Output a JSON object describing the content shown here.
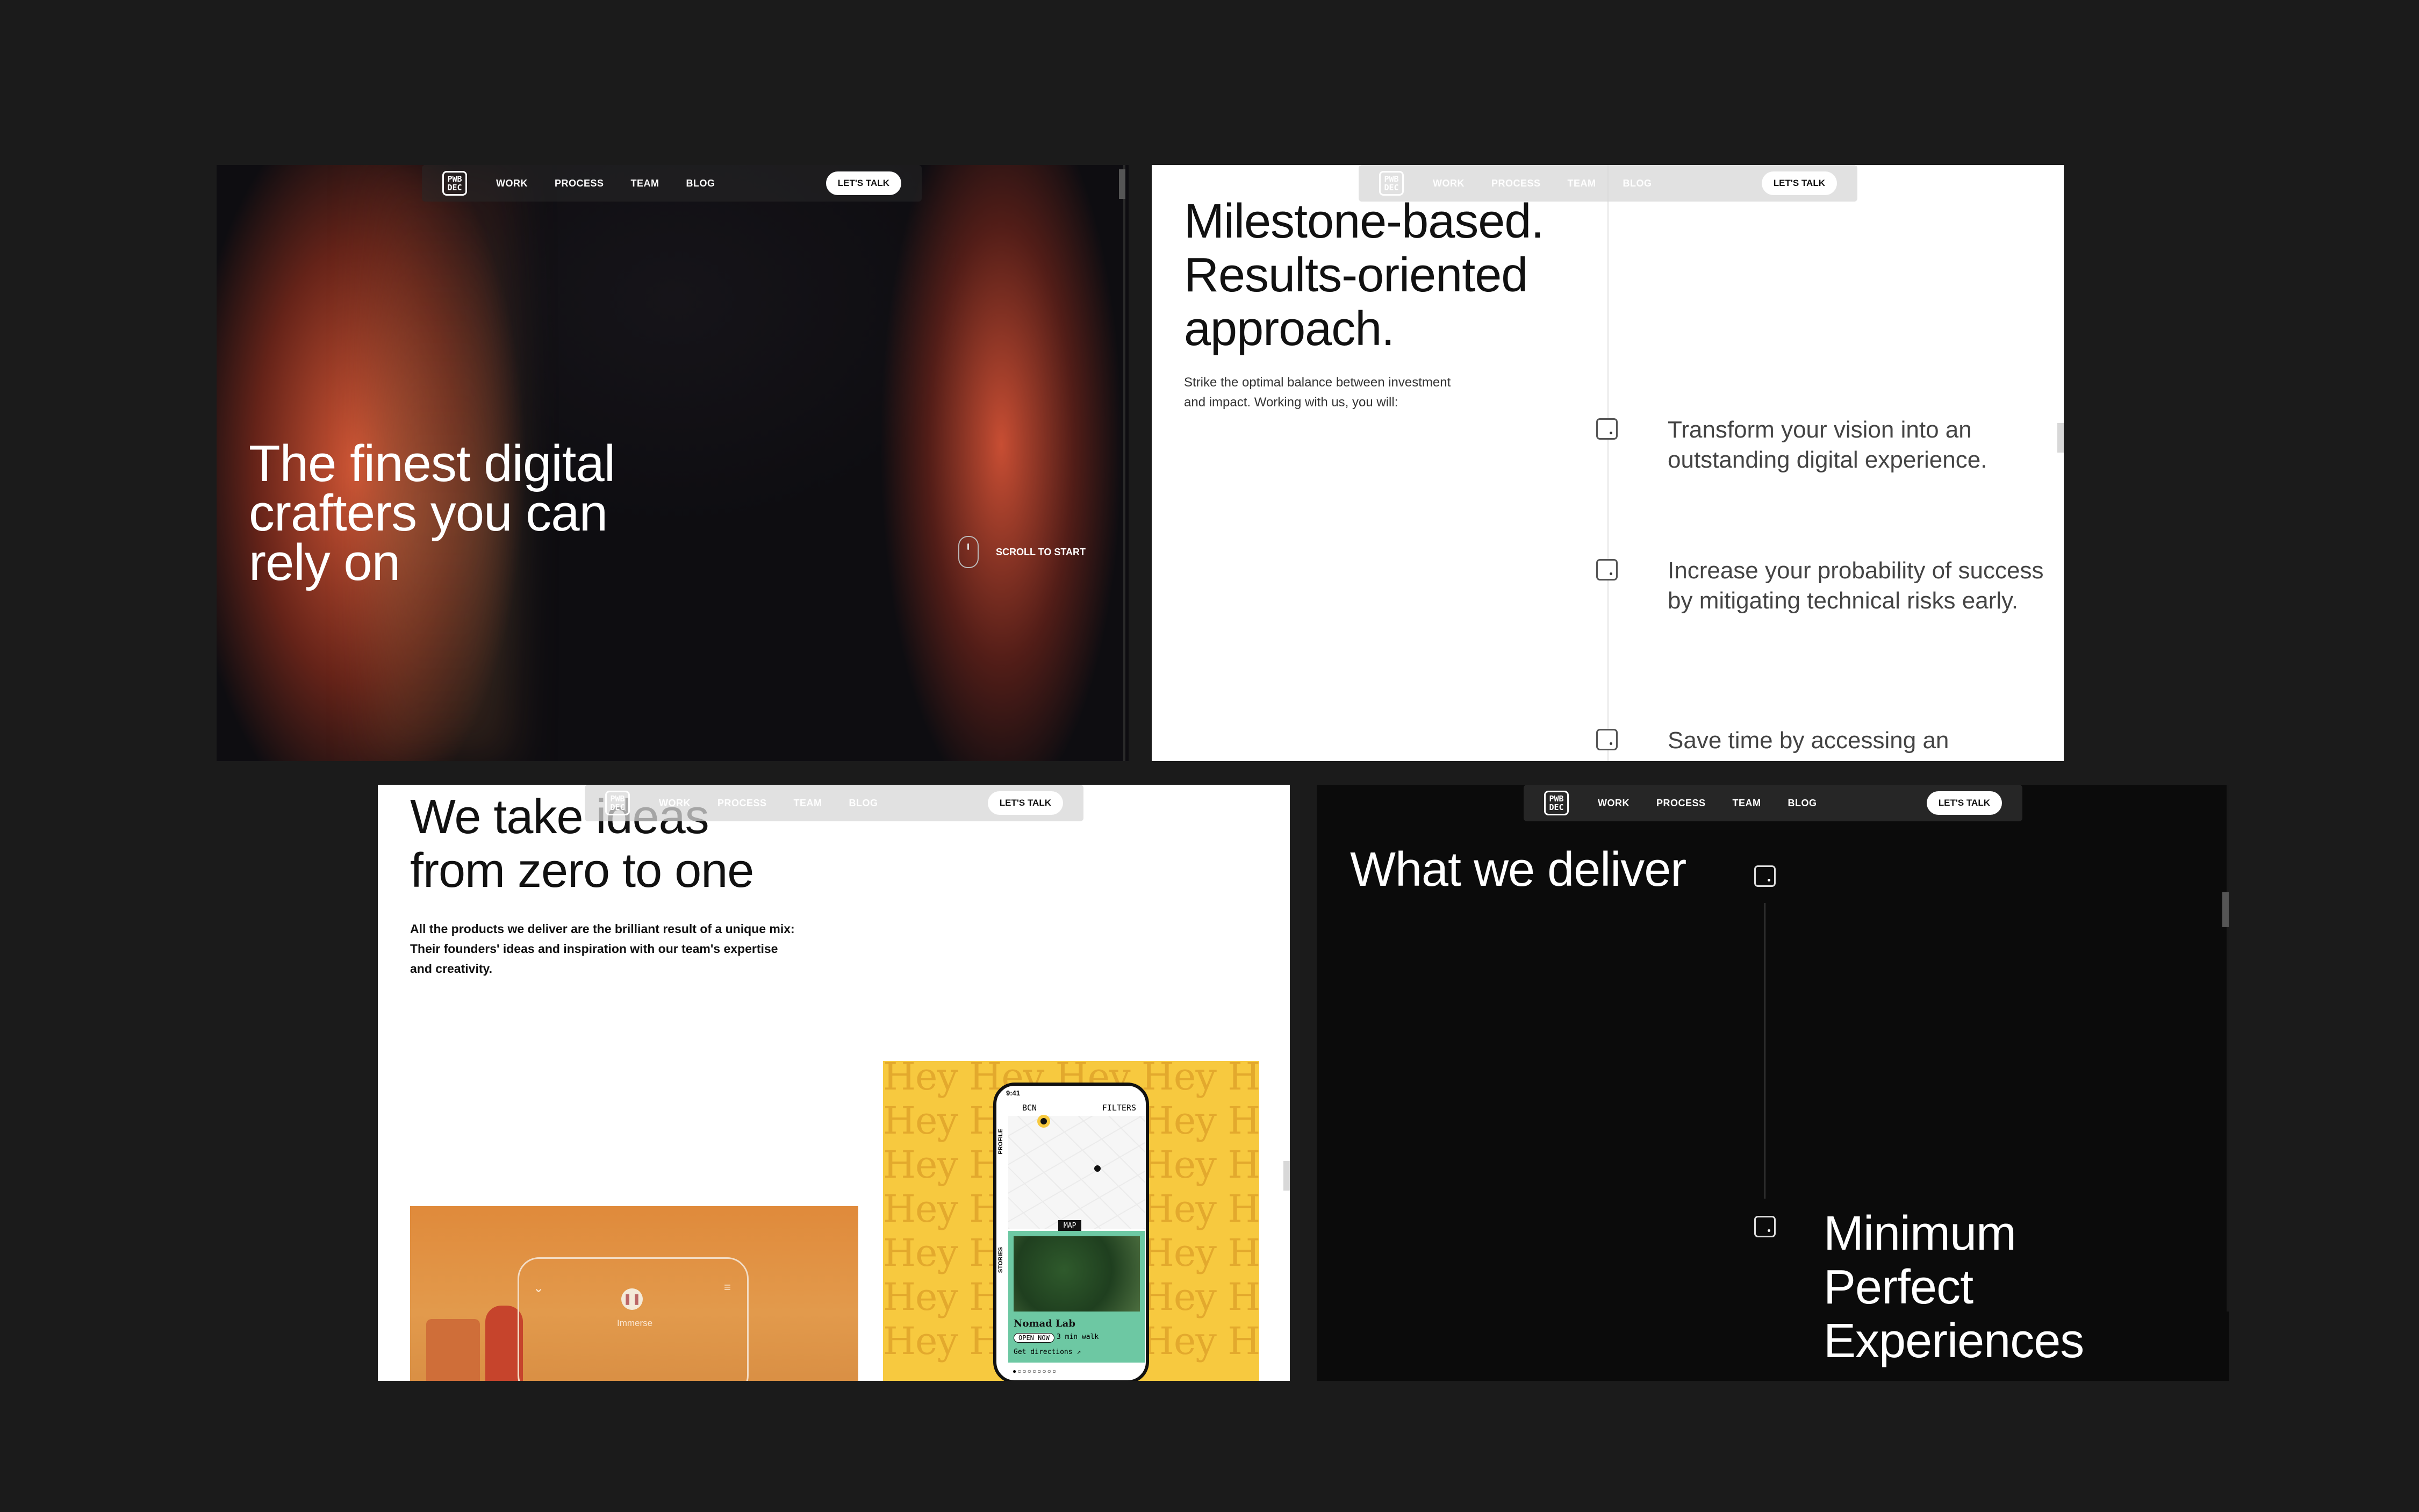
{
  "nav": {
    "logo_line1": "PWB",
    "logo_line2": "DEC",
    "items": [
      "WORK",
      "PROCESS",
      "TEAM",
      "BLOG"
    ],
    "cta": "LET'S TALK"
  },
  "panel1": {
    "hero_line1": "The finest digital",
    "hero_line2": "crafters you can",
    "hero_line3": "rely on",
    "scroll_label": "SCROLL TO START"
  },
  "panel2": {
    "title_line1": "Milestone-based.",
    "title_line2": "Results-oriented",
    "title_line3": "approach.",
    "subtitle_line1": "Strike the optimal balance between investment",
    "subtitle_line2": "and impact. Working with us, you will:",
    "points": [
      "Transform your vision into an outstanding digital experience.",
      "Increase your probability of success by mitigating technical risks early.",
      "Save time by accessing an"
    ]
  },
  "panel3": {
    "title_line1": "We take ideas",
    "title_line2": "from zero to one",
    "subtitle_line1": "All the products we deliver are the brilliant result of a unique mix:",
    "subtitle_line2": "Their founders' ideas and inspiration with our team's expertise",
    "subtitle_line3": "and creativity.",
    "orange_card": {
      "label": "Immerse"
    },
    "yellow_card": {
      "pattern_word": "Hey",
      "phone": {
        "time": "9:41",
        "city": "BCN",
        "filters": "FILTERS",
        "profile": "PROFILE",
        "stories": "STORIES",
        "map_tag": "MAP",
        "venue": "Nomad Lab",
        "pill": "OPEN NOW",
        "walk": "3 min walk",
        "directions": "Get directions ↗"
      }
    }
  },
  "panel4": {
    "title": "What we deliver",
    "item_line1": "Minimum",
    "item_line2": "Perfect",
    "item_line3": "Experiences"
  }
}
